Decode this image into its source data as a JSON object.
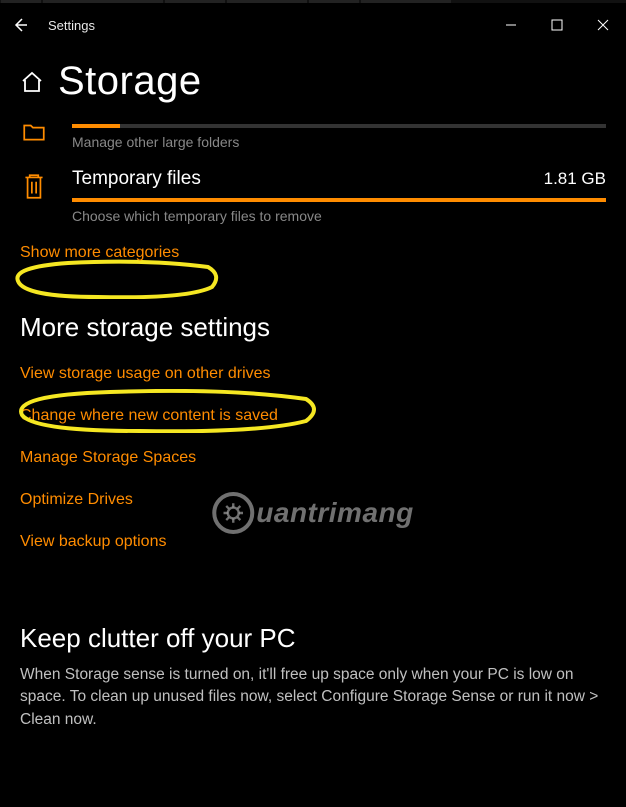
{
  "window_title": "Settings",
  "page_title": "Storage",
  "categories": {
    "other": {
      "name": "",
      "hint": "Manage other large folders",
      "fill_pct": 9
    },
    "temp": {
      "name": "Temporary files",
      "size": "1.81 GB",
      "hint": "Choose which temporary files to remove",
      "fill_pct": 100
    }
  },
  "show_more": "Show more categories",
  "more_settings_title": "More storage settings",
  "links": {
    "view_other": "View storage usage on other drives",
    "change_saved": "Change where new content is saved",
    "manage_spaces": "Manage Storage Spaces",
    "optimize": "Optimize Drives",
    "backup": "View backup options"
  },
  "keep_title": "Keep clutter off your PC",
  "keep_text": "When Storage sense is turned on, it'll free up space only when your PC is low on space. To clean up unused files now, select Configure Storage Sense or run it now > Clean now.",
  "watermark": "uantrimang",
  "colors": {
    "accent": "#ff8c00",
    "highlight": "#f5e722"
  }
}
